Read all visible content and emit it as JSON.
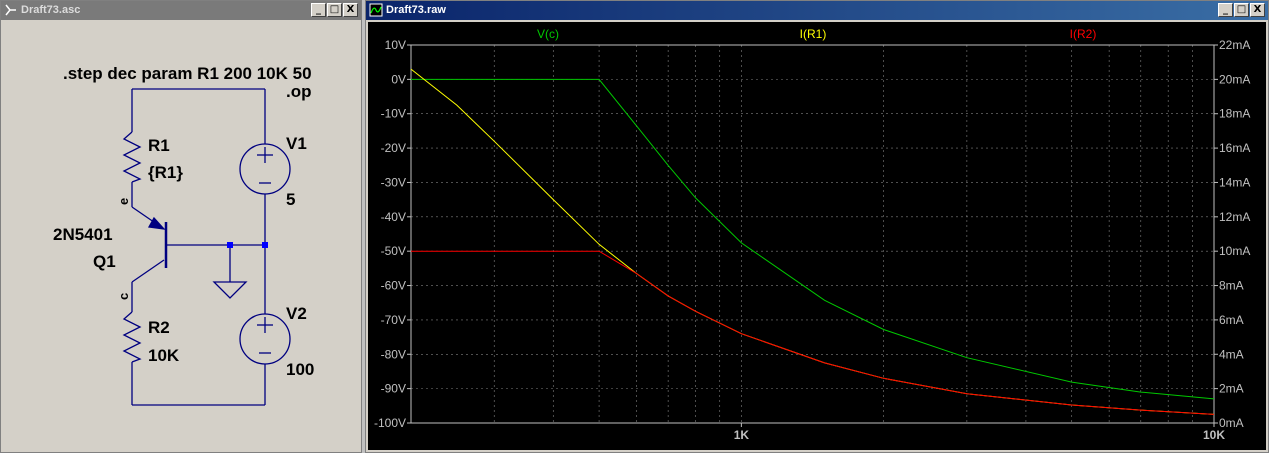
{
  "schematic_window": {
    "title": "Draft73.asc",
    "buttons": {
      "minimize": "_",
      "restore": "□",
      "close": "X"
    },
    "directive_step": ".step dec param R1 200 10K 50",
    "directive_op": ".op",
    "components": {
      "r1_name": "R1",
      "r1_value": "{R1}",
      "r2_name": "R2",
      "r2_value": "10K",
      "q1_model": "2N5401",
      "q1_name": "Q1",
      "v1_name": "V1",
      "v1_value": "5",
      "v2_name": "V2",
      "v2_value": "100",
      "net_e": "e",
      "net_c": "c"
    }
  },
  "plot_window": {
    "title": "Draft73.raw",
    "buttons": {
      "minimize": "_",
      "restore": "□",
      "close": "X"
    }
  },
  "chart_data": {
    "type": "line",
    "x_scale": "log",
    "xlim": [
      200,
      10000
    ],
    "x_tick_labels": [
      "1K",
      "10K"
    ],
    "x_ticks": [
      1000,
      10000
    ],
    "left_axis": {
      "ylim": [
        -100,
        10
      ],
      "ticks": [
        "10V",
        "0V",
        "-10V",
        "-20V",
        "-30V",
        "-40V",
        "-50V",
        "-60V",
        "-70V",
        "-80V",
        "-90V",
        "-100V"
      ],
      "tick_values": [
        10,
        0,
        -10,
        -20,
        -30,
        -40,
        -50,
        -60,
        -70,
        -80,
        -90,
        -100
      ]
    },
    "right_axis": {
      "ylim": [
        0,
        22
      ],
      "ticks": [
        "22mA",
        "20mA",
        "18mA",
        "16mA",
        "14mA",
        "12mA",
        "10mA",
        "8mA",
        "6mA",
        "4mA",
        "2mA",
        "0mA"
      ],
      "tick_values": [
        22,
        20,
        18,
        16,
        14,
        12,
        10,
        8,
        6,
        4,
        2,
        0
      ]
    },
    "grid": true,
    "background": "#000000",
    "series": [
      {
        "name": "V(c)",
        "axis": "left",
        "color": "#00c800",
        "x": [
          200,
          300,
          400,
          500,
          600,
          700,
          800,
          1000,
          1500,
          2000,
          3000,
          5000,
          7000,
          10000
        ],
        "y": [
          0,
          0,
          0,
          0,
          -13.5,
          -25,
          -34.5,
          -47.6,
          -64.3,
          -72.8,
          -81,
          -88.1,
          -91,
          -93
        ]
      },
      {
        "name": "I(R1)",
        "axis": "right",
        "color": "#ffff00",
        "x": [
          200,
          250,
          300,
          400,
          500,
          600,
          700,
          800,
          1000,
          1500,
          2000,
          3000,
          5000,
          7000,
          10000
        ],
        "y": [
          20.6,
          18.5,
          16.4,
          13.0,
          10.4,
          8.7,
          7.4,
          6.5,
          5.2,
          3.5,
          2.6,
          1.7,
          1.05,
          0.75,
          0.5
        ]
      },
      {
        "name": "I(R2)",
        "axis": "right",
        "color": "#ff0000",
        "x": [
          200,
          300,
          400,
          500,
          600,
          700,
          800,
          1000,
          1500,
          2000,
          3000,
          5000,
          7000,
          10000
        ],
        "y": [
          10.0,
          10.0,
          10.0,
          10.0,
          8.7,
          7.4,
          6.5,
          5.2,
          3.5,
          2.6,
          1.7,
          1.05,
          0.75,
          0.5
        ]
      }
    ]
  }
}
